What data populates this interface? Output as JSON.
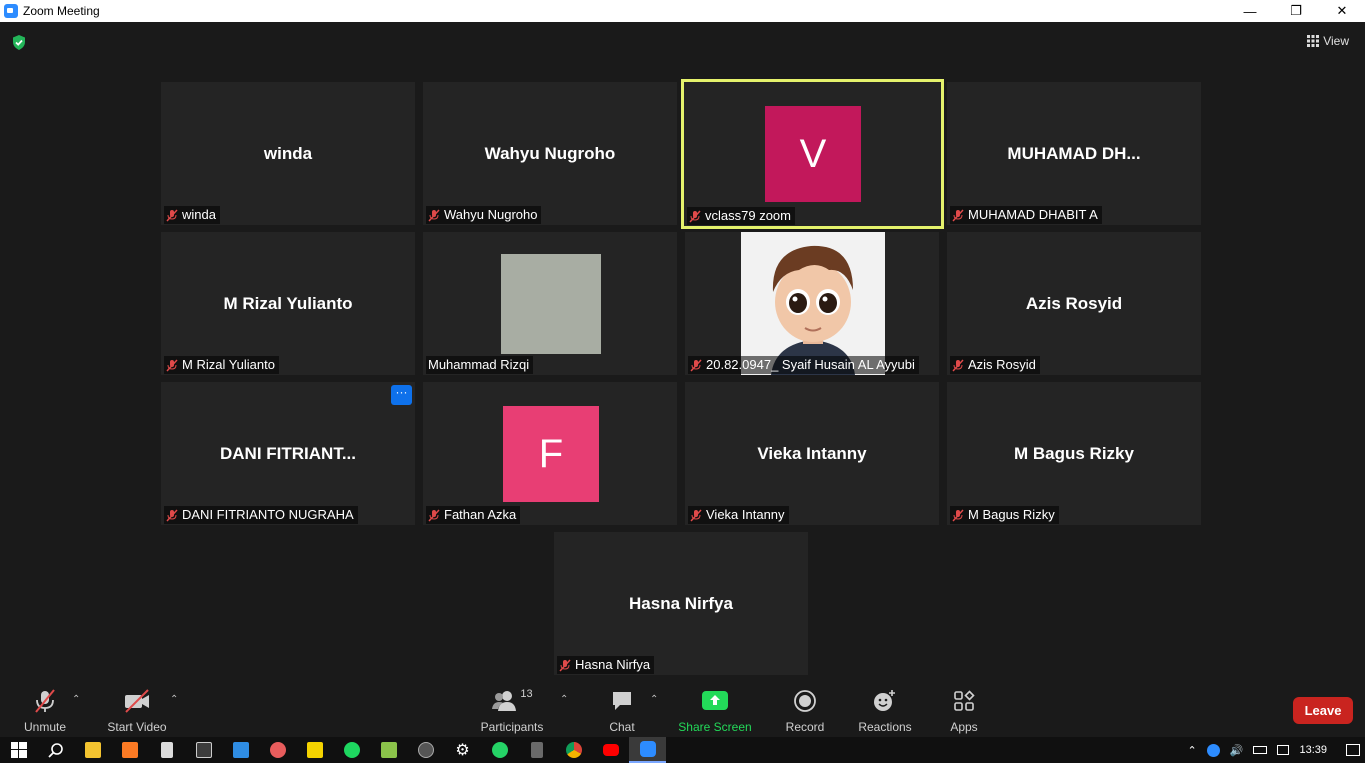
{
  "window": {
    "title": "Zoom Meeting"
  },
  "top": {
    "view_label": "View"
  },
  "tiles": [
    {
      "center": "winda",
      "label": "winda",
      "muted": true
    },
    {
      "center": "Wahyu Nugroho",
      "label": "Wahyu Nugroho",
      "muted": true
    },
    {
      "letter": "V",
      "label": "vclass79 zoom",
      "muted": true,
      "color": "#c2185b"
    },
    {
      "center": "MUHAMAD  DH...",
      "label": "MUHAMAD DHABIT A",
      "muted": true
    },
    {
      "center": "M Rizal Yulianto",
      "label": "M Rizal Yulianto",
      "muted": true
    },
    {
      "label": "Muhammad Rizqi",
      "muted": false
    },
    {
      "label": "20.82.0947_ Syaif Husain AL Ayyubi",
      "muted": true
    },
    {
      "center": "Azis Rosyid",
      "label": "Azis Rosyid",
      "muted": true
    },
    {
      "center": "DANI  FITRIANT...",
      "label": "DANI FITRIANTO NUGRAHA",
      "muted": true,
      "more": "···"
    },
    {
      "letter": "F",
      "label": "Fathan Azka",
      "muted": true,
      "color": "#e83e74"
    },
    {
      "center": "Vieka Intanny",
      "label": "Vieka Intanny",
      "muted": true
    },
    {
      "center": "M Bagus Rizky",
      "label": "M Bagus Rizky",
      "muted": true
    },
    {
      "center": "Hasna Nirfya",
      "label": "Hasna Nirfya",
      "muted": true
    }
  ],
  "toolbar": {
    "unmute": "Unmute",
    "start_video": "Start Video",
    "participants": "Participants",
    "participants_count": "13",
    "chat": "Chat",
    "share_screen": "Share Screen",
    "record": "Record",
    "reactions": "Reactions",
    "apps": "Apps",
    "leave": "Leave"
  },
  "colors": {
    "share": "#23d959",
    "leave": "#c9241f",
    "active_border": "#e5f26c",
    "muted_icon": "#e04a4a"
  },
  "taskbar": {
    "clock": "13:39"
  }
}
